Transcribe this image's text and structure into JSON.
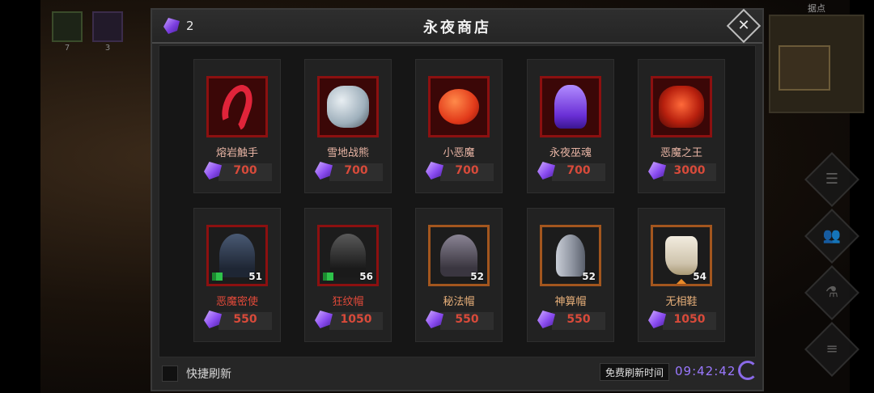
{
  "hud": {
    "skill_counts": [
      "7",
      "3"
    ],
    "minimap_label": "据点"
  },
  "shop": {
    "title": "永夜商店",
    "gem_count": "2",
    "close_icon": "close-icon",
    "items": [
      {
        "name": "熔岩触手",
        "price": "700",
        "level": "",
        "frame": "red",
        "art": "scorpion"
      },
      {
        "name": "雪地战熊",
        "price": "700",
        "level": "",
        "frame": "red",
        "art": "bear"
      },
      {
        "name": "小恶魔",
        "price": "700",
        "level": "",
        "frame": "red",
        "art": "imp"
      },
      {
        "name": "永夜巫魂",
        "price": "700",
        "level": "",
        "frame": "red",
        "art": "wraith"
      },
      {
        "name": "恶魔之王",
        "price": "3000",
        "level": "",
        "frame": "red",
        "art": "demon"
      },
      {
        "name": "恶魔密使",
        "price": "550",
        "level": "51",
        "frame": "red",
        "art": "hood"
      },
      {
        "name": "狂纹帽",
        "price": "1050",
        "level": "56",
        "frame": "red",
        "art": "hood2"
      },
      {
        "name": "秘法帽",
        "price": "550",
        "level": "52",
        "frame": "orange",
        "art": "hood3"
      },
      {
        "name": "神算帽",
        "price": "550",
        "level": "52",
        "frame": "orange",
        "art": "helm"
      },
      {
        "name": "无相鞋",
        "price": "1050",
        "level": "54",
        "frame": "orange",
        "art": "boot"
      }
    ],
    "footer": {
      "quick_refresh_label": "快捷刷新",
      "free_refresh_label": "免费刷新时间",
      "timer": "09:42:42"
    }
  },
  "colors": {
    "accent_purple": "#9a78ff",
    "price_red": "#d84a3a",
    "frame_red": "#8c1010",
    "frame_orange": "#a3561e"
  }
}
